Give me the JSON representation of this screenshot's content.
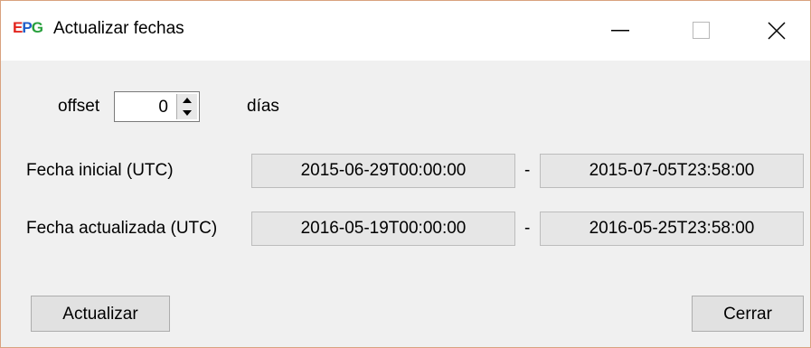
{
  "window": {
    "logo": {
      "e": "E",
      "p": "P",
      "g": "G"
    },
    "title": "Actualizar fechas",
    "controls": {
      "minimize": "minimize-icon",
      "maximize": "maximize-icon",
      "close": "close-icon"
    }
  },
  "offset": {
    "label": "offset",
    "value": "0",
    "unit": "días"
  },
  "dates": {
    "initial": {
      "label": "Fecha inicial (UTC)",
      "start": "2015-06-29T00:00:00",
      "separator": "-",
      "end": "2015-07-05T23:58:00"
    },
    "updated": {
      "label": "Fecha actualizada (UTC)",
      "start": "2016-05-19T00:00:00",
      "separator": "-",
      "end": "2016-05-25T23:58:00"
    }
  },
  "buttons": {
    "update": "Actualizar",
    "close": "Cerrar"
  },
  "colors": {
    "border_accent": "#d9a27f",
    "logo_e": "#e3261f",
    "logo_p": "#1f5ec9",
    "logo_g": "#28a03c"
  }
}
